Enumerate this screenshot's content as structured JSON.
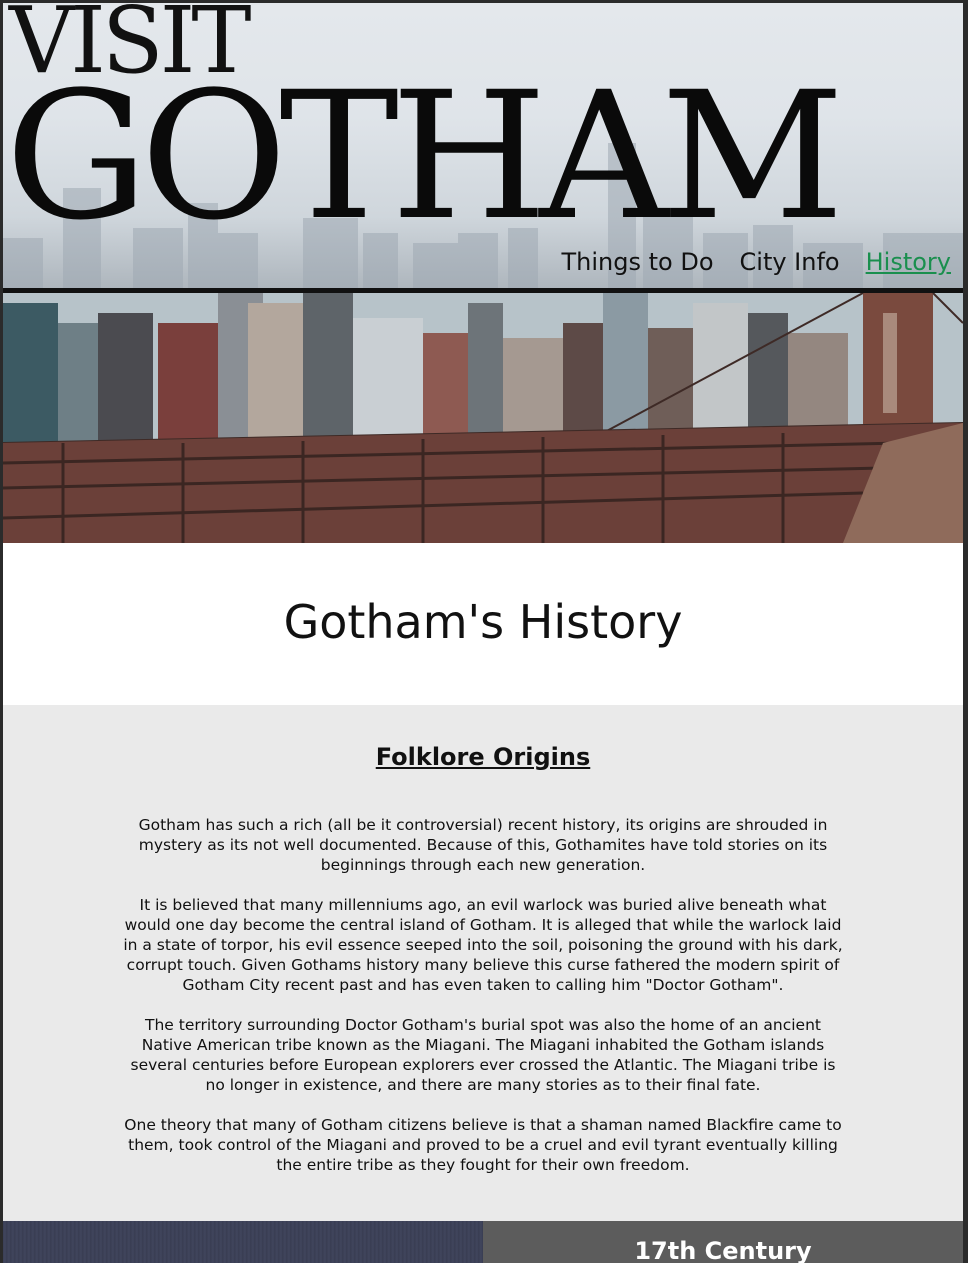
{
  "header": {
    "logo_top": "VISIT",
    "logo_main": "GOTHAM",
    "nav": [
      {
        "label": "Things to Do",
        "active": false
      },
      {
        "label": "City Info",
        "active": false
      },
      {
        "label": "History",
        "active": true
      }
    ]
  },
  "main": {
    "title": "Gotham's History"
  },
  "folklore": {
    "heading": "Folklore Origins",
    "paragraphs": [
      "Gotham has such a rich (all be it controversial) recent history, its origins are shrouded in mystery as its not well documented. Because of this, Gothamites have told stories on its beginnings through each new generation.",
      "It is believed that many millenniums ago, an evil warlock was buried alive beneath what would one day become the central island of Gotham. It is alleged that while the warlock laid in a state of torpor, his evil essence seeped into the soil, poisoning the ground with his dark, corrupt touch. Given Gothams history many believe this curse fathered the modern spirit of Gotham City recent past and has even taken to calling him \"Doctor Gotham\".",
      "The territory surrounding Doctor Gotham's burial spot was also the home of an ancient Native American tribe known as the Miagani. The Miagani inhabited the Gotham islands several centuries before European explorers ever crossed the Atlantic. The Miagani tribe is no longer in existence, and there are many stories as to their final fate.",
      "One theory that many of Gotham citizens believe is that a shaman named Blackfire came to them, took control of the Miagani and proved to be a cruel and evil tyrant eventually killing the entire tribe as they fought for their own freedom."
    ]
  },
  "timeline": {
    "heading": "17th Century"
  },
  "colors": {
    "accent_link": "#1a8f4e",
    "section_bg": "#eaeaea",
    "timeline_bg": "#5c5c5c"
  }
}
